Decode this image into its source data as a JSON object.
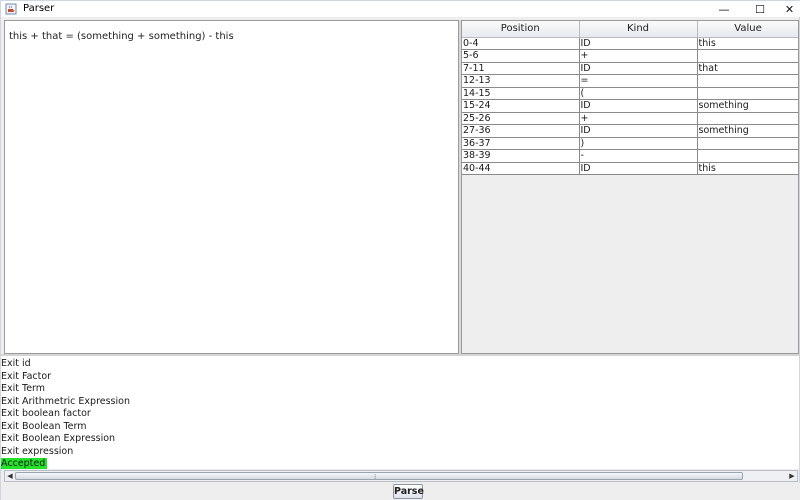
{
  "window": {
    "title": "Parser",
    "minimize_glyph": "—",
    "maximize_glyph": "☐",
    "close_glyph": "✕",
    "icon": "java-cup-icon"
  },
  "editor": {
    "text": "this + that = (something + something) - this"
  },
  "token_table": {
    "columns": [
      "Position",
      "Kind",
      "Value"
    ],
    "rows": [
      [
        "0-4",
        "ID",
        "this"
      ],
      [
        "5-6",
        "+",
        ""
      ],
      [
        "7-11",
        "ID",
        "that"
      ],
      [
        "12-13",
        "=",
        ""
      ],
      [
        "14-15",
        "(",
        ""
      ],
      [
        "15-24",
        "ID",
        "something"
      ],
      [
        "25-26",
        "+",
        ""
      ],
      [
        "27-36",
        "ID",
        "something"
      ],
      [
        "36-37",
        ")",
        ""
      ],
      [
        "38-39",
        "-",
        ""
      ],
      [
        "40-44",
        "ID",
        "this"
      ]
    ]
  },
  "log": {
    "lines": [
      "Exit id",
      "Exit Factor",
      "Exit Term",
      "Exit Arithmetric Expression",
      "Exit boolean factor",
      "Exit Boolean Term",
      "Exit Boolean Expression",
      "Exit expression",
      "Accepted"
    ],
    "accepted_color": "#22e22a"
  },
  "scrollbar": {
    "left_arrow": "◀",
    "right_arrow": "▶",
    "grip": "⁞"
  },
  "actions": {
    "parse_label": "Parse"
  },
  "colors": {
    "header_bg": "#e6e9ee",
    "window_bg": "#eeeeee",
    "accepted": "#22e22a"
  }
}
